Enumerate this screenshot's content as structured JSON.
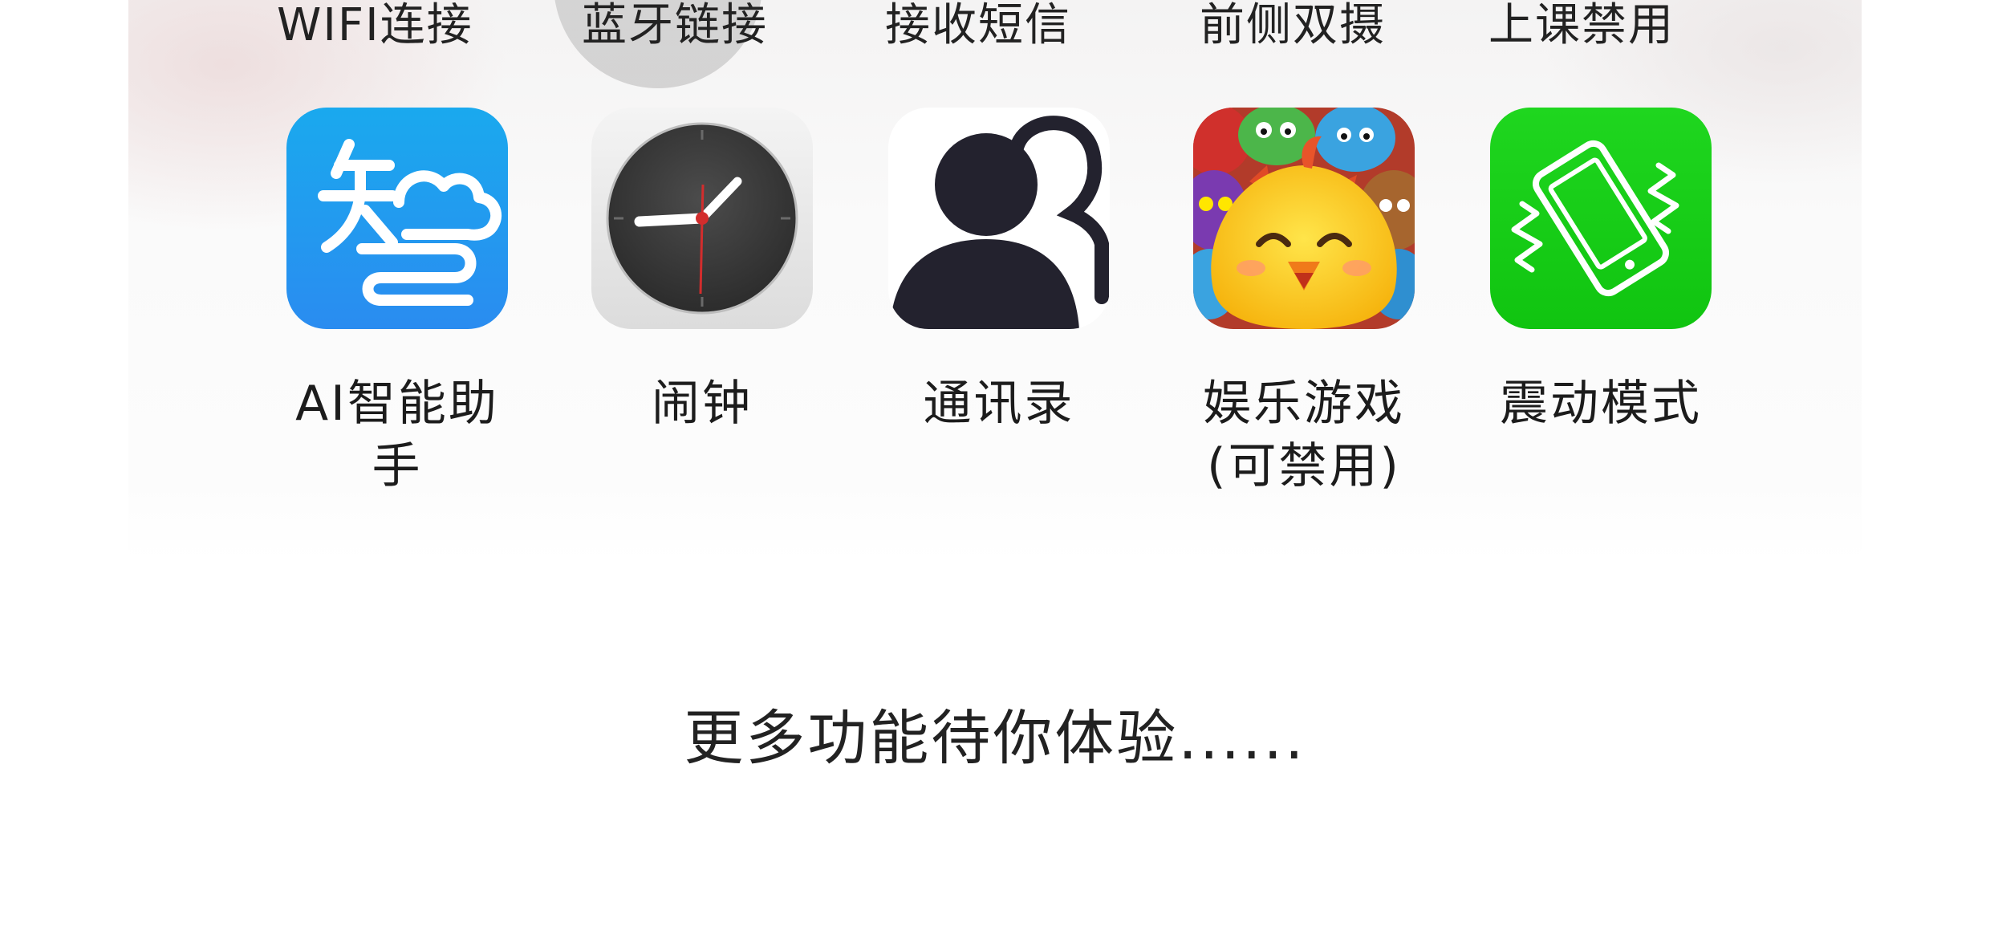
{
  "top_row": {
    "labels": [
      "WIFI连接",
      "蓝牙链接",
      "接收短信",
      "前侧双摄",
      "上课禁用"
    ]
  },
  "apps": [
    {
      "label": "AI智能助手",
      "icon": "ai-assistant-icon",
      "color": "#2196f3"
    },
    {
      "label": "闹钟",
      "icon": "alarm-clock-icon",
      "color": "#3b3b3b"
    },
    {
      "label": "通讯录",
      "icon": "contacts-icon",
      "color": "#23222e"
    },
    {
      "label": "娱乐游戏\n(可禁用)",
      "icon": "game-icon",
      "color": "#f9c91a"
    },
    {
      "label": "震动模式",
      "icon": "vibration-mode-icon",
      "color": "#14cc14"
    }
  ],
  "footer": {
    "more_text": "更多功能待你体验......"
  }
}
